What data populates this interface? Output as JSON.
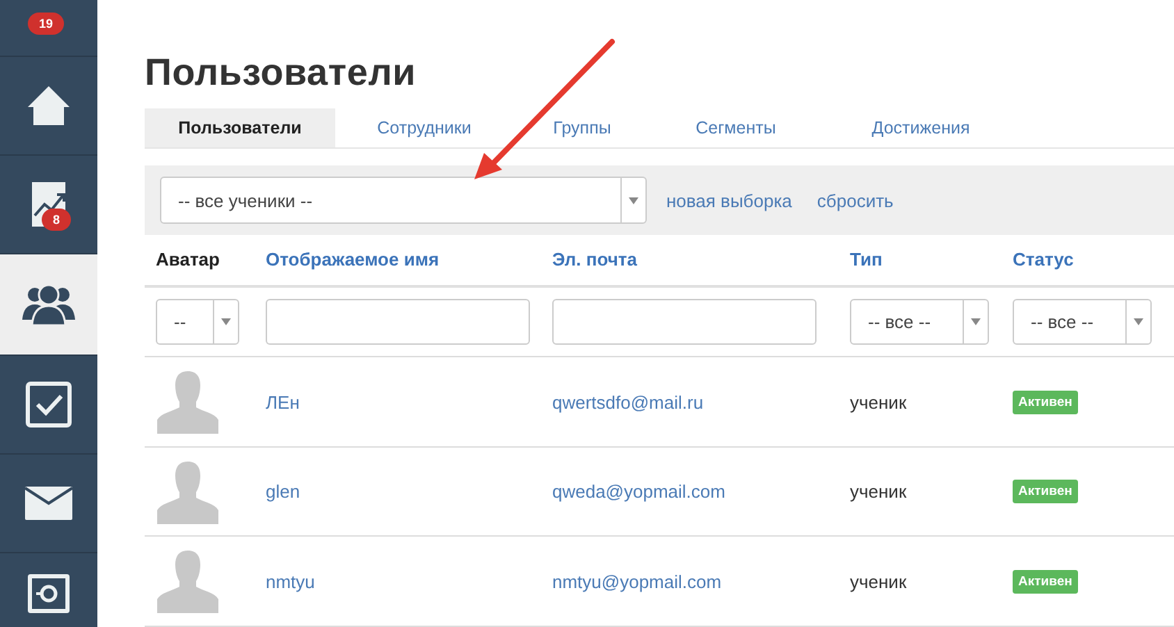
{
  "sidebar": {
    "items": [
      {
        "badge": "19",
        "selected": false
      },
      {
        "selected": false
      },
      {
        "badge": "8",
        "selected": false
      },
      {
        "selected": true
      },
      {
        "selected": false
      },
      {
        "selected": false
      },
      {
        "selected": false
      }
    ]
  },
  "title": "Пользователи",
  "tabs": [
    {
      "label": "Пользователи",
      "selected": true
    },
    {
      "label": "Сотрудники",
      "selected": false
    },
    {
      "label": "Группы",
      "selected": false
    },
    {
      "label": "Сегменты",
      "selected": false
    },
    {
      "label": "Достижения",
      "selected": false
    }
  ],
  "filter_bar": {
    "select_value": "-- все ученики --",
    "links": [
      "новая выборка",
      "сбросить"
    ]
  },
  "table": {
    "columns": [
      {
        "label": "Аватар",
        "link": false
      },
      {
        "label": "Отображаемое имя",
        "link": true
      },
      {
        "label": "Эл. почта",
        "link": true
      },
      {
        "label": "Тип",
        "link": true
      },
      {
        "label": "Статус",
        "link": true
      }
    ],
    "filters": [
      {
        "kind": "select",
        "value": "--"
      },
      {
        "kind": "text"
      },
      {
        "kind": "text"
      },
      {
        "kind": "select",
        "value": "-- все --"
      },
      {
        "kind": "select",
        "value": "-- все --"
      }
    ],
    "rows": [
      {
        "name": "ЛЕн",
        "email": "qwertsdfo@mail.ru",
        "type": "ученик",
        "status": "Активен"
      },
      {
        "name": "glen",
        "email": "qweda@yopmail.com",
        "type": "ученик",
        "status": "Активен"
      },
      {
        "name": "nmtyu",
        "email": "nmtyu@yopmail.com",
        "type": "ученик",
        "status": "Активен"
      }
    ]
  }
}
